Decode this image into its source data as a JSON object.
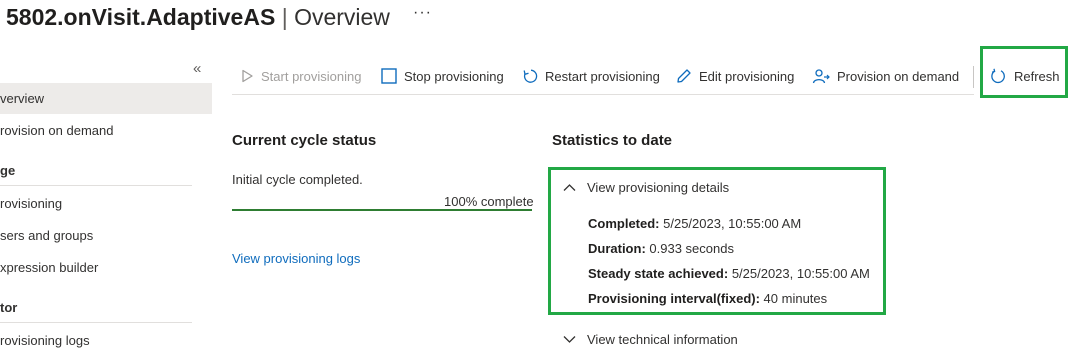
{
  "header": {
    "app_name": "5802.onVisit.AdaptiveAS",
    "separator": "|",
    "page_name": "Overview",
    "more": "···"
  },
  "sidebar": {
    "collapse_glyph": "«",
    "items": [
      {
        "label": "verview",
        "selected": true
      },
      {
        "label": "rovision on demand"
      },
      {
        "group": "ge"
      },
      {
        "label": "rovisioning"
      },
      {
        "label": "sers and groups"
      },
      {
        "label": "xpression builder"
      },
      {
        "group": "tor"
      },
      {
        "label": "rovisioning logs"
      }
    ]
  },
  "toolbar": {
    "start": "Start provisioning",
    "stop": "Stop provisioning",
    "restart": "Restart provisioning",
    "edit": "Edit provisioning",
    "on_demand": "Provision on demand",
    "refresh": "Refresh"
  },
  "cycle": {
    "heading": "Current cycle status",
    "status_text": "Initial cycle completed.",
    "progress_percent": 100,
    "progress_label": "100% complete",
    "logs_link": "View provisioning logs"
  },
  "stats": {
    "heading": "Statistics to date",
    "details_toggle": "View provisioning details",
    "completed_label": "Completed:",
    "completed_value": "5/25/2023, 10:55:00 AM",
    "duration_label": "Duration:",
    "duration_value": "0.933 seconds",
    "steady_label": "Steady state achieved:",
    "steady_value": "5/25/2023, 10:55:00 AM",
    "interval_label": "Provisioning interval(fixed):",
    "interval_value": "40 minutes",
    "tech_toggle": "View technical information"
  },
  "colors": {
    "highlight": "#22a845",
    "link": "#0f6cbd",
    "progress": "#2e7d32"
  },
  "icons": [
    "play-icon",
    "stop-icon",
    "restart-icon",
    "edit-icon",
    "provision-user-icon",
    "refresh-icon",
    "chevron-up-icon",
    "chevron-down-icon",
    "collapse-icon",
    "more-icon"
  ]
}
